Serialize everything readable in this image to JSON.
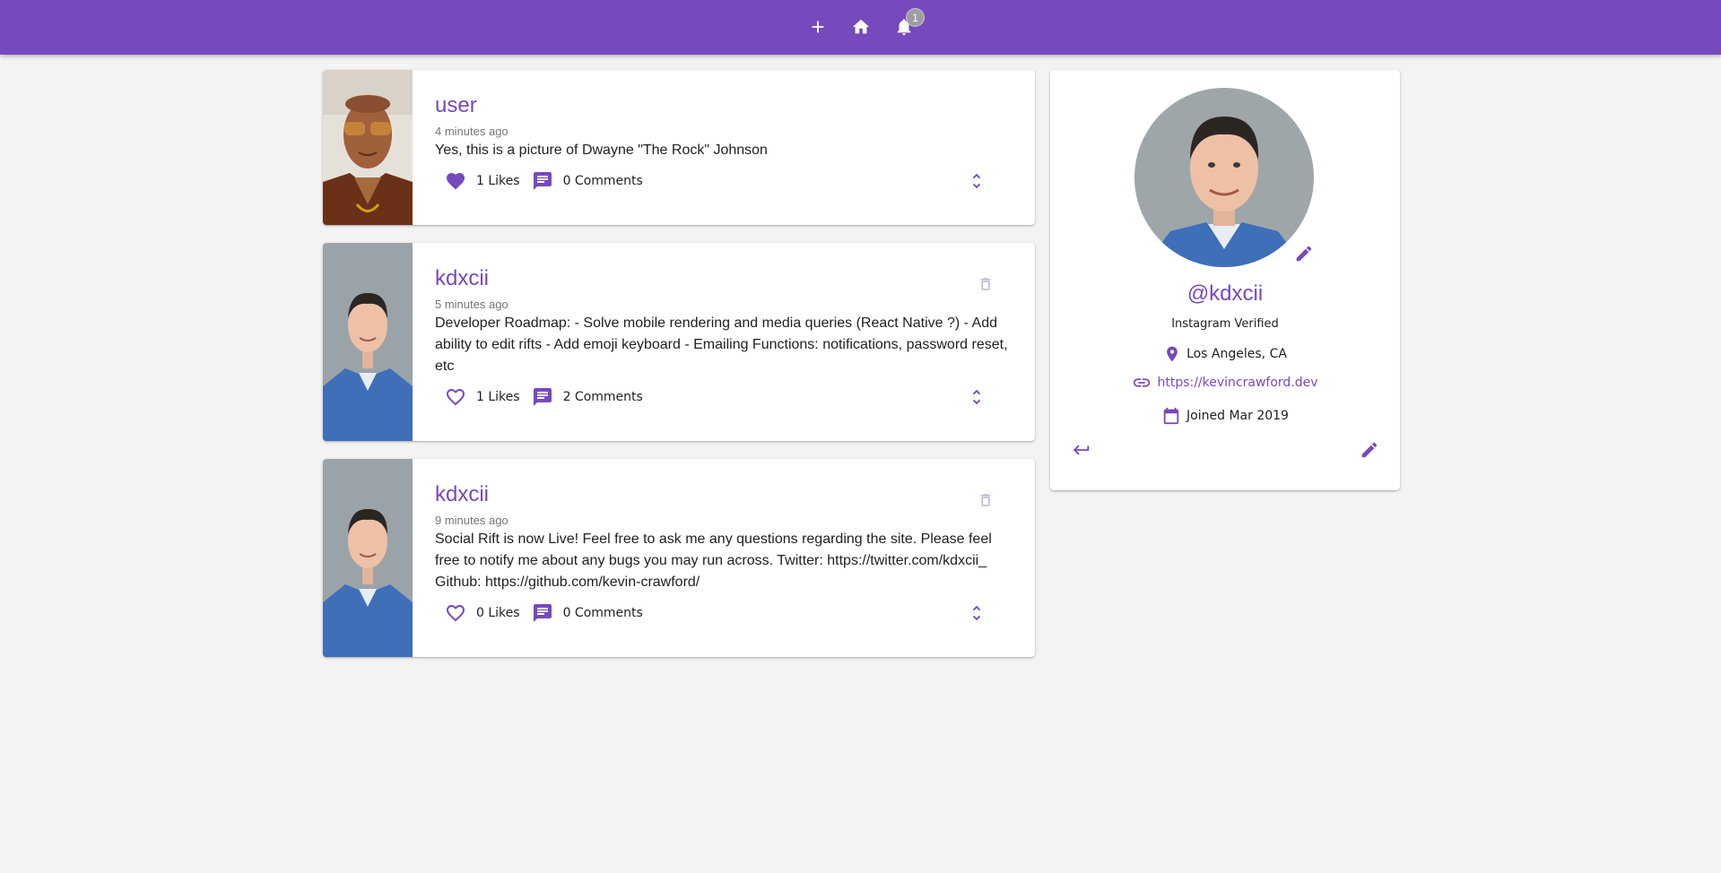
{
  "colors": {
    "primary": "#7649bd",
    "background": "#f3f3f3",
    "badge": "#9e9e9e"
  },
  "appbar": {
    "icons": [
      "add-icon",
      "home-icon",
      "notifications-icon"
    ],
    "notification_count": "1"
  },
  "posts": [
    {
      "username": "user",
      "time": "4 minutes ago",
      "body": "Yes, this is a picture of Dwayne \"The Rock\" Johnson",
      "likes": "1 Likes",
      "comments": "0 Comments",
      "liked": true,
      "deletable": false,
      "image": "dwayne-johnson-photo"
    },
    {
      "username": "kdxcii",
      "time": "5 minutes ago",
      "body": "Developer Roadmap: - Solve mobile rendering and media queries (React Native ?) - Add ability to edit rifts - Add emoji keyboard - Emailing Functions: notifications, password reset, etc",
      "likes": "1 Likes",
      "comments": "2 Comments",
      "liked": false,
      "deletable": true,
      "image": "kdxcii-profile-photo"
    },
    {
      "username": "kdxcii",
      "time": "9 minutes ago",
      "body": "Social Rift is now Live! Feel free to ask me any questions regarding the site. Please feel free to notify me about any bugs you may run across. Twitter: https://twitter.com/kdxcii_ Github: https://github.com/kevin-crawford/",
      "likes": "0 Likes",
      "comments": "0 Comments",
      "liked": false,
      "deletable": true,
      "image": "kdxcii-profile-photo"
    }
  ],
  "profile": {
    "handle": "@kdxcii",
    "bio": "Instagram Verified",
    "location": "Los Angeles, CA",
    "website": "https://kevincrawford.dev",
    "joined": "Joined Mar 2019"
  }
}
